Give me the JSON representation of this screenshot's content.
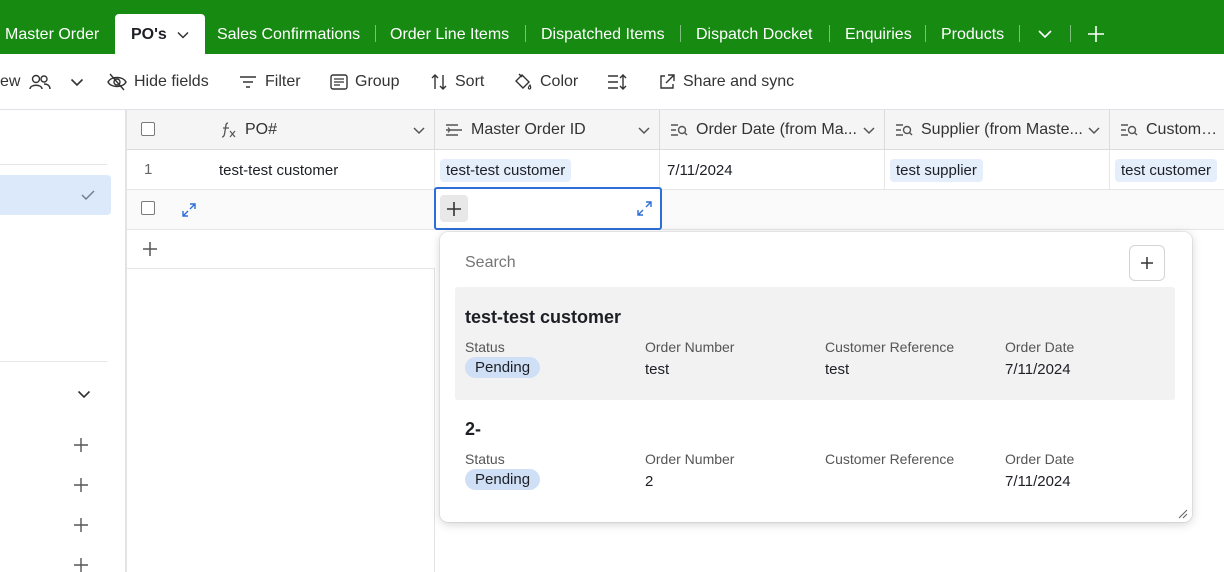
{
  "tabs": [
    {
      "label": "Master Order"
    },
    {
      "label": "PO's",
      "active": true
    },
    {
      "label": "Sales Confirmations"
    },
    {
      "label": "Order Line Items"
    },
    {
      "label": "Dispatched Items"
    },
    {
      "label": "Dispatch Docket"
    },
    {
      "label": "Enquiries"
    },
    {
      "label": "Products"
    }
  ],
  "toolbar": {
    "view_label": "ew",
    "hide_fields": "Hide fields",
    "filter": "Filter",
    "group": "Group",
    "sort": "Sort",
    "color": "Color",
    "share": "Share and sync"
  },
  "columns": [
    {
      "label": "PO#",
      "icon": "formula-icon"
    },
    {
      "label": "Master Order ID",
      "icon": "link-icon"
    },
    {
      "label": "Order Date (from Ma...",
      "icon": "lookup-icon"
    },
    {
      "label": "Supplier (from Maste...",
      "icon": "lookup-icon"
    },
    {
      "label": "Customer (f",
      "icon": "lookup-icon"
    }
  ],
  "rows": [
    {
      "num": "1",
      "po": "test-test customer",
      "master_order": "test-test customer",
      "order_date": "7/11/2024",
      "supplier": "test supplier",
      "customer": "test customer"
    }
  ],
  "popup": {
    "search_placeholder": "Search",
    "records": [
      {
        "title": "test-test customer",
        "status_label": "Status",
        "status": "Pending",
        "order_number_label": "Order Number",
        "order_number": "test",
        "customer_ref_label": "Customer Reference",
        "customer_ref": "test",
        "order_date_label": "Order Date",
        "order_date": "7/11/2024"
      },
      {
        "title": "2-",
        "status_label": "Status",
        "status": "Pending",
        "order_number_label": "Order Number",
        "order_number": "2",
        "customer_ref_label": "Customer Reference",
        "customer_ref": "",
        "order_date_label": "Order Date",
        "order_date": "7/11/2024"
      }
    ]
  },
  "colors": {
    "brand_green": "#178a12",
    "selection_blue": "#2d6fd6",
    "chip_blue": "#e5eefb",
    "pill_blue": "#cfdff5"
  }
}
